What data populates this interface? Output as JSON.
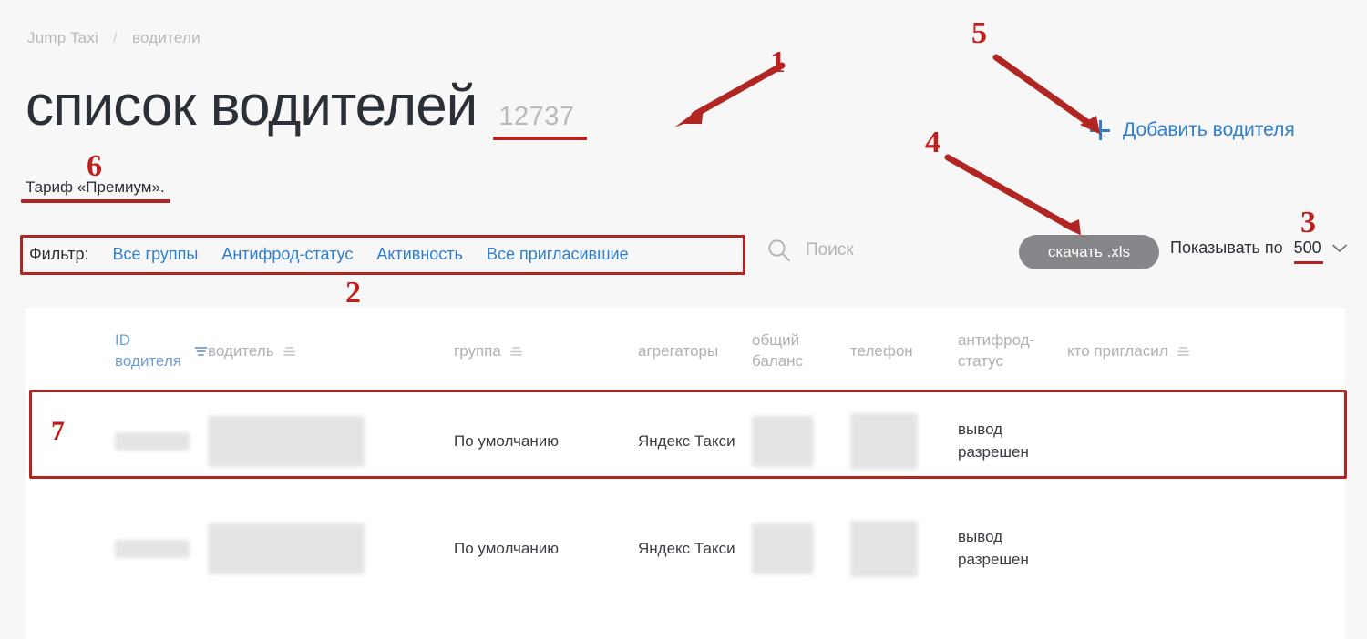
{
  "breadcrumb": {
    "root": "Jump Taxi",
    "separator": "/",
    "current": "водители"
  },
  "header": {
    "title": "список водителей",
    "count": "12737",
    "tariff": "Тариф «Премиум».",
    "add_driver_label": "Добавить водителя",
    "add_driver_icon": "plus-icon"
  },
  "toolbar": {
    "filter_label": "Фильтр:",
    "filters": [
      {
        "label": "Все группы"
      },
      {
        "label": "Антифрод-статус"
      },
      {
        "label": "Активность"
      },
      {
        "label": "Все пригласившие"
      }
    ],
    "search_placeholder": "Поиск",
    "search_icon": "search-icon",
    "download_label": "скачать .xls",
    "per_page_label": "Показывать по",
    "per_page_value": "500",
    "per_page_icon": "chevron-down-icon"
  },
  "table": {
    "columns": [
      {
        "id": "id",
        "label": "ID водителя",
        "sort_icon": "filter-sort-icon",
        "active": true
      },
      {
        "id": "driver",
        "label": "водитель",
        "sort_icon": "sort-icon",
        "active": false
      },
      {
        "id": "group",
        "label": "группа",
        "sort_icon": "sort-icon",
        "active": false
      },
      {
        "id": "aggregators",
        "label": "агрегаторы",
        "sort_icon": null,
        "active": false
      },
      {
        "id": "balance",
        "label_line1": "общий",
        "label_line2": "баланс",
        "sort_icon": null,
        "active": false
      },
      {
        "id": "phone",
        "label": "телефон",
        "sort_icon": null,
        "active": false
      },
      {
        "id": "antifraud",
        "label_line1": "антифрод-",
        "label_line2": "статус",
        "sort_icon": null,
        "active": false
      },
      {
        "id": "invited_by",
        "label": "кто пригласил",
        "sort_icon": "sort-icon",
        "active": false
      }
    ],
    "rows": [
      {
        "id": "",
        "driver": "",
        "group_line1": "По",
        "group_line2": "умолчанию",
        "aggregator_line1": "Яндекс",
        "aggregator_line2": "Такси",
        "balance": "",
        "phone": "",
        "antifraud_line1": "вывод",
        "antifraud_line2": "разрешен",
        "invited_by": ""
      },
      {
        "id": "",
        "driver": "",
        "group_line1": "По",
        "group_line2": "умолчанию",
        "aggregator_line1": "Яндекс",
        "aggregator_line2": "Такси",
        "balance": "",
        "phone": "",
        "antifraud_line1": "вывод",
        "antifraud_line2": "разрешен",
        "invited_by": ""
      }
    ]
  },
  "annotations": {
    "markers": [
      {
        "id": "1",
        "label": "1"
      },
      {
        "id": "2",
        "label": "2"
      },
      {
        "id": "3",
        "label": "3"
      },
      {
        "id": "4",
        "label": "4"
      },
      {
        "id": "5",
        "label": "5"
      },
      {
        "id": "6",
        "label": "6"
      },
      {
        "id": "7",
        "label": "7"
      }
    ],
    "color": "#c0201d"
  },
  "colors": {
    "accent_blue": "#2f7fd0",
    "annotation_red": "#b12522",
    "marker_red": "#c0201d",
    "text_dark": "#2b2f36",
    "text_muted": "#b0b0b6",
    "button_gray": "#85878a",
    "page_bg": "#f7f7f7",
    "panel_bg": "#ffffff"
  }
}
